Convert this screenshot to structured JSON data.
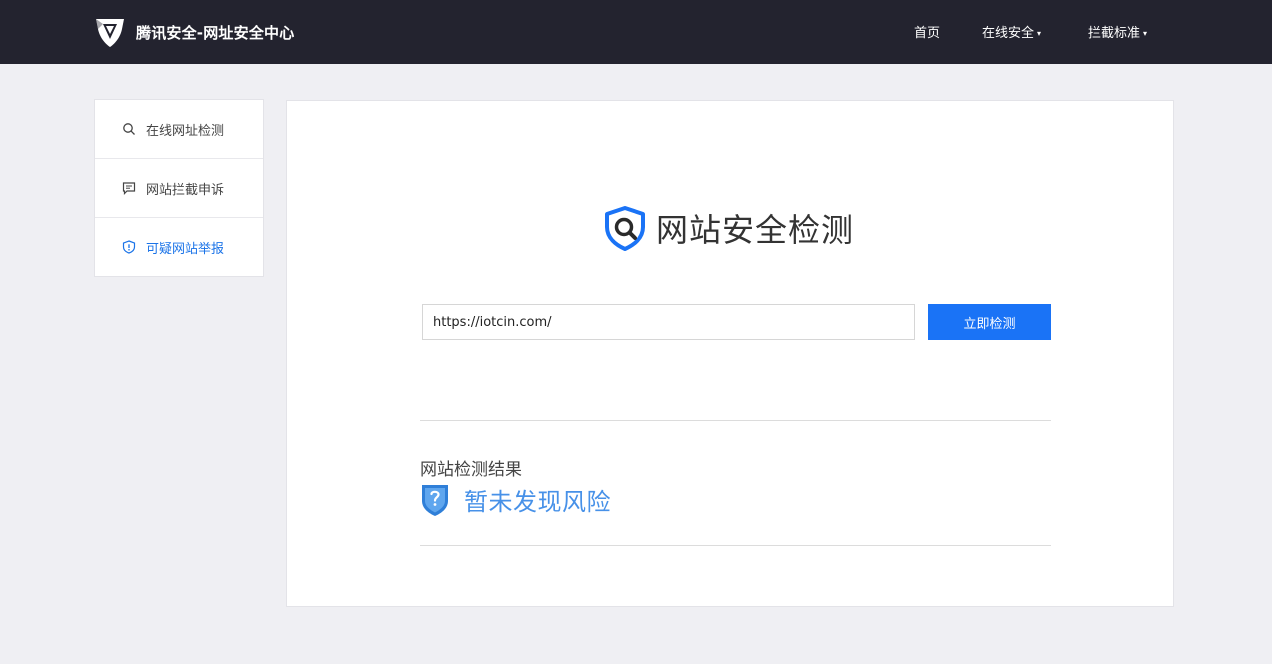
{
  "header": {
    "title": "腾讯安全-网址安全中心",
    "logo_icon": "tencent-shield-logo",
    "nav": [
      {
        "label": "首页",
        "has_caret": false
      },
      {
        "label": "在线安全",
        "has_caret": true
      },
      {
        "label": "拦截标准",
        "has_caret": true
      }
    ],
    "caret": "▾"
  },
  "sidebar": {
    "items": [
      {
        "label": "在线网址检测",
        "icon": "search-icon",
        "active": false
      },
      {
        "label": "网站拦截申诉",
        "icon": "message-icon",
        "active": false
      },
      {
        "label": "可疑网站举报",
        "icon": "shield-alert-icon",
        "active": true
      }
    ]
  },
  "main": {
    "title": "网站安全检测",
    "title_icon": "shield-search-icon",
    "search": {
      "value": "https://iotcin.com/",
      "placeholder": ""
    },
    "check_button": "立即检测",
    "result": {
      "label": "网站检测结果",
      "status": "暂未发现风险",
      "status_icon": "shield-question-icon"
    }
  },
  "colors": {
    "topbar": "#23232f",
    "accent": "#1a73f6",
    "active_link": "#1a73e8",
    "result_text": "#4791e8",
    "background": "#efeff3"
  }
}
